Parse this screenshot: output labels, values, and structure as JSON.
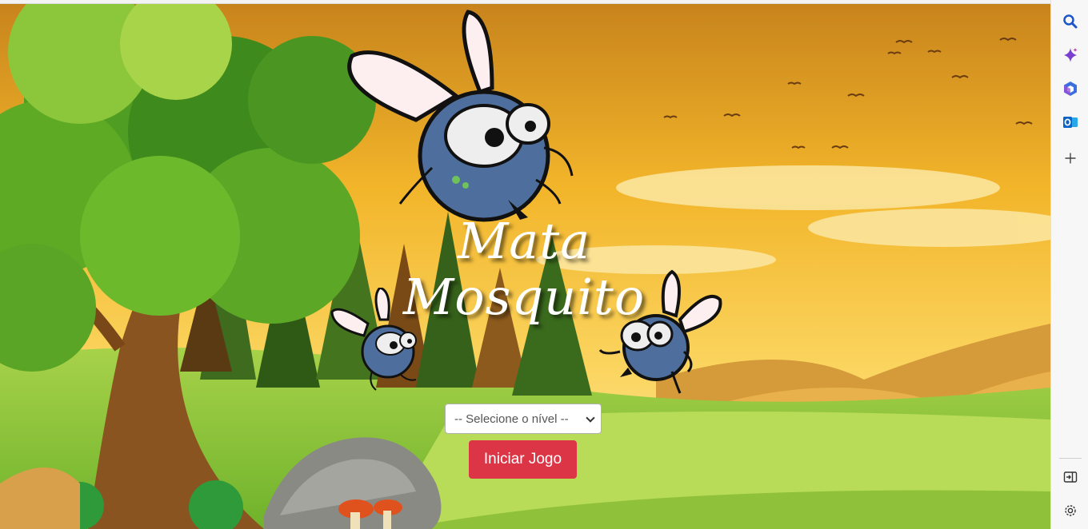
{
  "game": {
    "title_line1": "Mata",
    "title_line2": "Mosquito",
    "level_select": {
      "selected": "-- Selecione o nível --"
    },
    "start_button": "Iniciar Jogo"
  },
  "sidebar": {
    "items": [
      {
        "icon": "search-icon"
      },
      {
        "icon": "copilot-icon"
      },
      {
        "icon": "office-icon"
      },
      {
        "icon": "outlook-icon"
      },
      {
        "icon": "add-icon"
      }
    ],
    "bottom_items": [
      {
        "icon": "split-screen-icon"
      },
      {
        "icon": "settings-gear-icon"
      }
    ]
  }
}
